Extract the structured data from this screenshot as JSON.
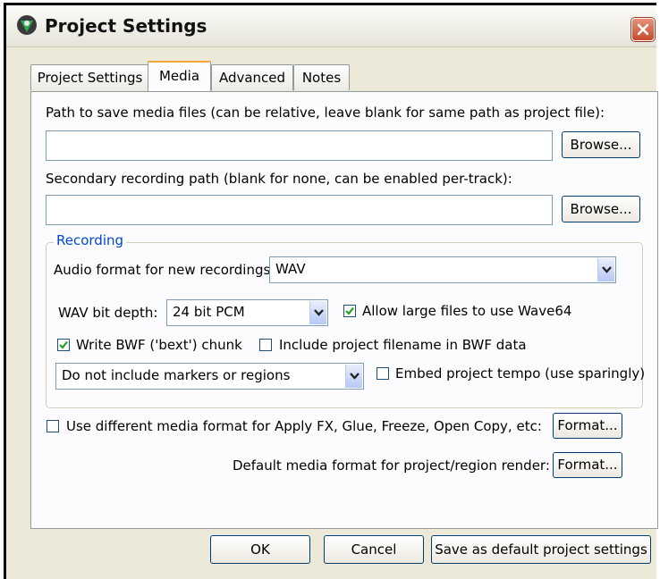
{
  "window": {
    "title": "Project Settings"
  },
  "tabs": [
    {
      "label": "Project Settings"
    },
    {
      "label": "Media",
      "active": true
    },
    {
      "label": "Advanced"
    },
    {
      "label": "Notes"
    }
  ],
  "media": {
    "path_label": "Path to save media files (can be relative, leave blank for same path as project file):",
    "path_value": "",
    "secondary_label": "Secondary recording path (blank for none, can be enabled per-track):",
    "secondary_value": "",
    "browse_label": "Browse..."
  },
  "recording": {
    "group_title": "Recording",
    "audio_format_label": "Audio format for new recordings:",
    "audio_format_value": "WAV",
    "bit_depth_label": "WAV bit depth:",
    "bit_depth_value": "24 bit PCM",
    "wave64_label": "Allow large files to use Wave64",
    "wave64_checked": true,
    "bwf_label": "Write BWF ('bext') chunk",
    "bwf_checked": true,
    "include_filename_label": "Include project filename in BWF data",
    "include_filename_checked": false,
    "markers_value": "Do not include markers or regions",
    "embed_tempo_label": "Embed project tempo (use sparingly)",
    "embed_tempo_checked": false
  },
  "media_format": {
    "different_format_label": "Use different media format for Apply FX, Glue, Freeze, Open Copy, etc:",
    "different_format_checked": false,
    "default_format_label": "Default media format for project/region render:",
    "format_button_label": "Format..."
  },
  "footer": {
    "ok_label": "OK",
    "cancel_label": "Cancel",
    "save_default_label": "Save as default project settings"
  },
  "colors": {
    "tab_accent": "#f5a83a",
    "group_title": "#0046d5",
    "checkmark": "#21a121",
    "close_button": "#c94a2c"
  },
  "icons": {
    "app": "reaper-logo-icon",
    "close": "close-icon",
    "dropdown": "chevron-down-icon",
    "check": "checkmark-icon"
  }
}
